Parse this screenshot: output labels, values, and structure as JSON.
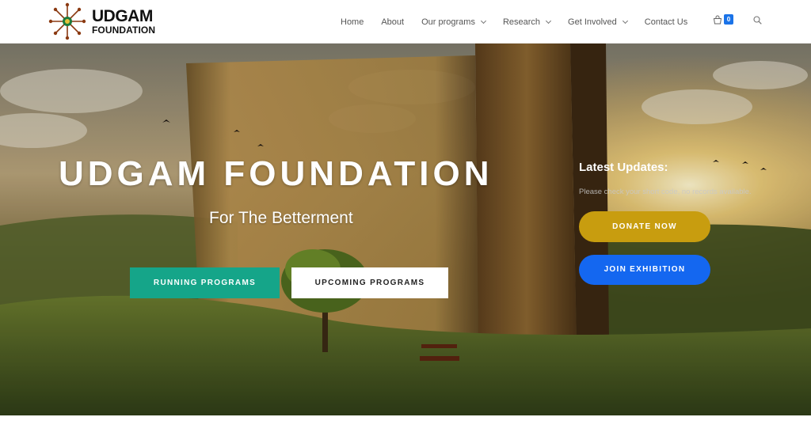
{
  "logo": {
    "line1": "UDGAM",
    "line2": "FOUNDATION"
  },
  "nav": {
    "home": "Home",
    "about": "About",
    "programs": "Our programs",
    "research": "Research",
    "involved": "Get Involved",
    "contact": "Contact Us"
  },
  "cart": {
    "count": "0"
  },
  "hero": {
    "title": "UDGAM FOUNDATION",
    "subtitle": "For The Betterment",
    "running_label": "RUNNING PROGRAMS",
    "upcoming_label": "UPCOMING PROGRAMS"
  },
  "updates": {
    "title": "Latest Updates:",
    "note": "Please check your short code, no records available.",
    "donate_label": "DONATE NOW",
    "join_label": "JOIN EXHIBITION"
  },
  "colors": {
    "accent_green": "#15a589",
    "donate_gold": "#c89d0f",
    "join_blue": "#1467f0",
    "badge_blue": "#1a73e8"
  },
  "icons": [
    "logo-mark-icon",
    "chevron-down-icon",
    "cart-icon",
    "search-icon"
  ]
}
